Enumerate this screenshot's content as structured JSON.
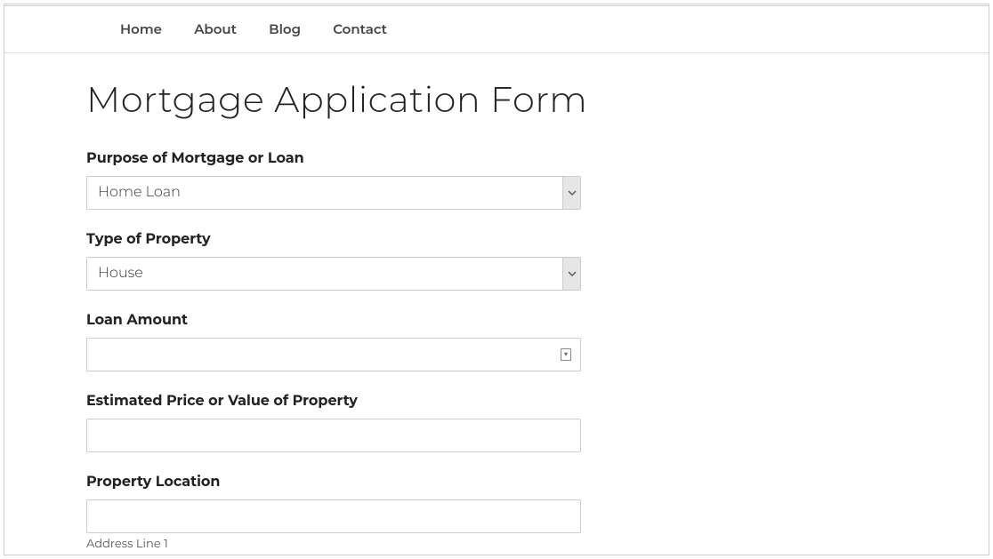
{
  "nav": {
    "items": [
      {
        "label": "Home"
      },
      {
        "label": "About"
      },
      {
        "label": "Blog"
      },
      {
        "label": "Contact"
      }
    ]
  },
  "page": {
    "title": "Mortgage Application Form"
  },
  "form": {
    "purpose": {
      "label": "Purpose of Mortgage or Loan",
      "value": "Home Loan"
    },
    "property_type": {
      "label": "Type of Property",
      "value": "House"
    },
    "loan_amount": {
      "label": "Loan Amount",
      "value": ""
    },
    "estimated_value": {
      "label": "Estimated Price or Value of Property",
      "value": ""
    },
    "property_location": {
      "label": "Property Location",
      "value": "",
      "sublabel": "Address Line 1"
    }
  }
}
